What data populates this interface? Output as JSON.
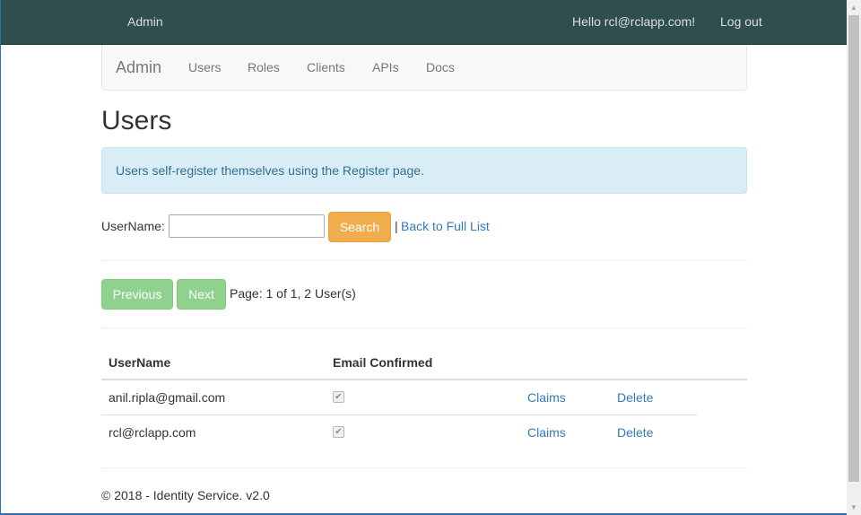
{
  "topbar": {
    "brand": "Admin",
    "greeting": "Hello rcl@rclapp.com!",
    "logout_label": "Log out",
    "background": "#2f4f4f"
  },
  "subnav": {
    "brand": "Admin",
    "links": [
      "Users",
      "Roles",
      "Clients",
      "APIs",
      "Docs"
    ]
  },
  "page": {
    "title": "Users",
    "info_alert": "Users self-register themselves using the Register page."
  },
  "search": {
    "label": "UserName:",
    "value": "",
    "button_label": "Search",
    "separator": "|",
    "back_link": "Back to Full List"
  },
  "pager": {
    "previous_label": "Previous",
    "next_label": "Next",
    "info": "Page: 1 of 1, 2 User(s)"
  },
  "table": {
    "headers": [
      "UserName",
      "Email Confirmed"
    ],
    "rows": [
      {
        "username": "anil.ripla@gmail.com",
        "email_confirmed": true,
        "claims": "Claims",
        "delete": "Delete"
      },
      {
        "username": "rcl@rclapp.com",
        "email_confirmed": true,
        "claims": "Claims",
        "delete": "Delete"
      }
    ]
  },
  "footer": {
    "text": "© 2018 - Identity Service. v2.0"
  },
  "colors": {
    "link": "#337ab7",
    "search_button": "#f0ad4e",
    "pager_button": "#8fd18f",
    "alert_bg": "#d9edf7"
  },
  "icons": {
    "checkbox": "checkmark-icon",
    "scroll_up": "scroll-up-arrow-icon",
    "scroll_down": "scroll-down-arrow-icon"
  }
}
